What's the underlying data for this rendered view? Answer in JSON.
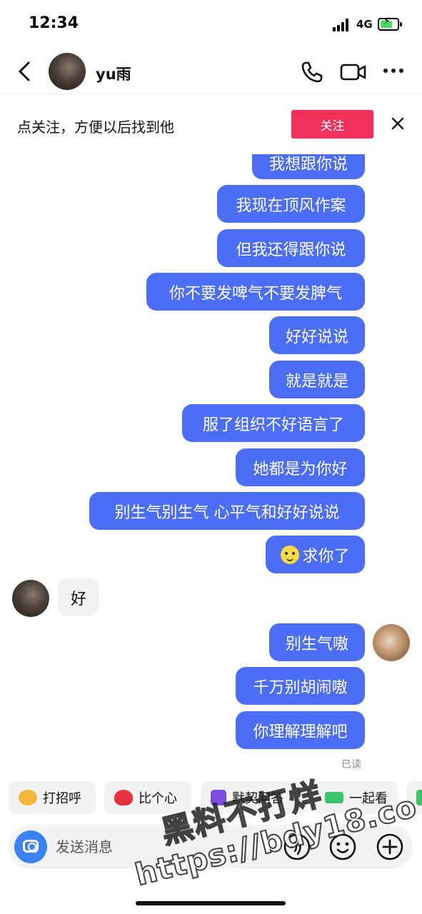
{
  "status_bar": {
    "time": "12:34",
    "network": "4G"
  },
  "header": {
    "contact_name": "yu雨"
  },
  "follow_banner": {
    "text": "点关注，方便以后找到他",
    "button_label": "关注"
  },
  "messages": [
    {
      "sender": "me",
      "text": "我想跟你说"
    },
    {
      "sender": "me",
      "text": "我现在顶风作案"
    },
    {
      "sender": "me",
      "text": "但我还得跟你说"
    },
    {
      "sender": "me",
      "text": "你不要发啤气不要发脾气"
    },
    {
      "sender": "me",
      "text": "好好说说"
    },
    {
      "sender": "me",
      "text": "就是就是"
    },
    {
      "sender": "me",
      "text": "服了组织不好语言了"
    },
    {
      "sender": "me",
      "text": "她都是为你好"
    },
    {
      "sender": "me",
      "text": "别生气别生气 心平气和好好说说"
    },
    {
      "sender": "me",
      "text": "求你了",
      "emoji": "smile-emoji"
    },
    {
      "sender": "contact",
      "text": "好"
    },
    {
      "sender": "me",
      "text": "别生气嗷"
    },
    {
      "sender": "me",
      "text": "千万别胡闹嗷"
    },
    {
      "sender": "me",
      "text": "你理解理解吧"
    }
  ],
  "read_receipt": "已读",
  "quick_replies": [
    {
      "label": "打招呼",
      "icon": "wave-emoji",
      "color": "#f5b63c"
    },
    {
      "label": "比个心",
      "icon": "heart-emoji",
      "color": "#e8313f"
    },
    {
      "label": "默契问答",
      "icon": "quiz-icon",
      "color": "#7b4ce0"
    },
    {
      "label": "一起看",
      "icon": "sofa-icon",
      "color": "#3cc26b"
    }
  ],
  "input": {
    "placeholder": "发送消息"
  },
  "watermark": {
    "line1": "黑料不打烊",
    "line2": "https://bdy18.co"
  },
  "colors": {
    "bubble_me": "#4c6ef5",
    "bubble_contact": "#f2f2f2",
    "follow_button": "#f0315a",
    "camera_button": "#3b82f6"
  }
}
